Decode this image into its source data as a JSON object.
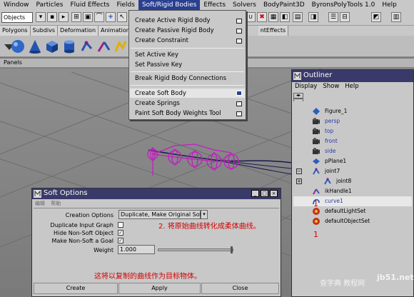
{
  "menubar": {
    "items": [
      "Window",
      "Particles",
      "Fluid Effects",
      "Fields",
      "Soft/Rigid Bodies",
      "Effects",
      "Solvers",
      "BodyPaint3D",
      "ByronsPolyTools 1.0",
      "Help"
    ]
  },
  "statusline": {
    "selection_mode": "Objects"
  },
  "shelf": {
    "tabs": [
      "Polygons",
      "Subdivs",
      "Deformation",
      "Animation",
      "Dy",
      "ntEffects"
    ]
  },
  "panels": {
    "label": "Panels"
  },
  "dropdown": {
    "items": [
      "Create Active Rigid Body",
      "Create Passive Rigid Body",
      "Create Constraint",
      "Set Active Key",
      "Set Passive Key",
      "Break Rigid Body Connections",
      "Create Soft Body",
      "Create Springs",
      "Paint Soft Body Weights Tool"
    ]
  },
  "outliner": {
    "title": "Outliner",
    "menu": [
      "Display",
      "Show",
      "Help"
    ],
    "items": [
      "Figure_1",
      "persp",
      "top",
      "front",
      "side",
      "pPlane1",
      "joint7",
      "joint8",
      "ikHandle1",
      "curve1",
      "defaultLightSet",
      "defaultObjectSet"
    ],
    "numbers": [
      "1",
      "1"
    ]
  },
  "soft_options": {
    "title": "Soft Options",
    "creation_options_label": "Creation Options",
    "creation_options_value": "Duplicate, Make Original Soft",
    "duplicate_input_graph_label": "Duplicate Input Graph",
    "hide_non_soft_label": "Hide Non-Soft Object",
    "make_non_soft_goal_label": "Make Non-Soft a Goal",
    "weight_label": "Weight",
    "weight_value": "1.000",
    "create_button": "Create",
    "apply_button": "Apply",
    "close_button": "Close",
    "menu": [
      "编辑",
      "帮助"
    ]
  },
  "annotations": {
    "step2": "2. 将原始曲线转化成柔体曲线。",
    "note": "这将以复制的曲线作为目标物体。"
  },
  "watermark": {
    "text": "查字典 教程网",
    "domain": "jb51.net"
  }
}
